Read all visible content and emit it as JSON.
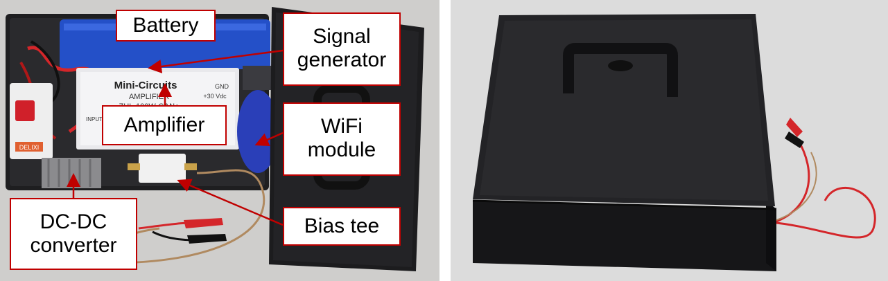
{
  "labels": {
    "battery": "Battery",
    "signal_generator": [
      "Signal",
      "generator"
    ],
    "amplifier": "Amplifier",
    "wifi_module": [
      "WiFi",
      "module"
    ],
    "dc_dc_converter": [
      "DC-DC",
      "converter"
    ],
    "bias_tee": "Bias tee"
  },
  "device_text": {
    "amp_brand": "Mini-Circuits",
    "amp_type": "AMPLIFIER",
    "amp_model": "ZHL-100W-GAN+",
    "amp_voltage": "+30 Vdc",
    "amp_gnd": "GND",
    "amp_input": "INPUT",
    "breaker_brand": "DELIXI"
  },
  "colors": {
    "label_border": "#c00000",
    "arrow": "#c00000",
    "battery_blue": "#2450c8",
    "case_black": "#1c1c1e",
    "wire_red": "#d4262a"
  }
}
